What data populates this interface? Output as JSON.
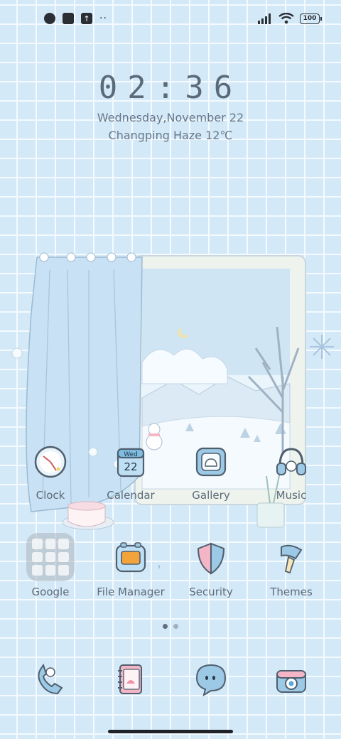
{
  "status_bar": {
    "battery": "100",
    "icons": [
      "app-notification-icon",
      "square-notification-icon",
      "upload-notification-icon",
      "more-notifications-icon",
      "signal-icon",
      "wifi-icon",
      "battery-icon"
    ]
  },
  "lock": {
    "time": "02:36",
    "date": "Wednesday,November 22",
    "weather": "Changping Haze 12℃"
  },
  "apps": [
    {
      "label": "Clock",
      "icon": "clock-icon"
    },
    {
      "label": "Calendar",
      "icon": "calendar-icon",
      "day_name": "Wed",
      "day_num": "22"
    },
    {
      "label": "Gallery",
      "icon": "gallery-icon"
    },
    {
      "label": "Music",
      "icon": "music-icon"
    },
    {
      "label": "Google",
      "icon": "folder-icon"
    },
    {
      "label": "File Manager",
      "icon": "file-manager-icon"
    },
    {
      "label": "Security",
      "icon": "security-shield-icon"
    },
    {
      "label": "Themes",
      "icon": "themes-brush-icon"
    }
  ],
  "page_indicator": {
    "pages": 2,
    "current": 1
  },
  "dock": [
    {
      "name": "phone",
      "icon": "phone-icon"
    },
    {
      "name": "contacts",
      "icon": "contacts-book-icon"
    },
    {
      "name": "messages",
      "icon": "messages-bubble-icon"
    },
    {
      "name": "camera",
      "icon": "camera-icon"
    }
  ],
  "colors": {
    "background": "#d4e9f7",
    "grid": "#f4faff",
    "text": "#5f6f7c",
    "accent_blue": "#5aa9d6",
    "accent_pink": "#f4b6c6",
    "accent_orange": "#f2a33a"
  }
}
